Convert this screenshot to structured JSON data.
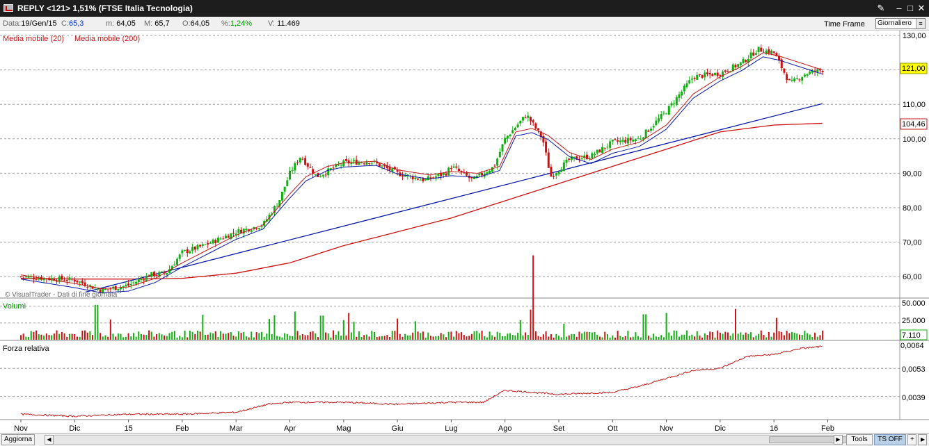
{
  "window": {
    "title": "REPLY <121> 1,51%  (FTSE Italia Tecnologia)",
    "buttons": [
      "tools-icon",
      "minimize-icon",
      "maximize-icon",
      "close-icon"
    ]
  },
  "info": {
    "data_label": "Data:",
    "data_value": "19/Gen/15",
    "c_label": "C:",
    "c_value": "65,3",
    "m_label": "m:",
    "m_value": "64,05",
    "M_label": "M:",
    "M_value": "65,7",
    "o_label": "O:",
    "o_value": "64,05",
    "pct_label": "%:",
    "pct_value": "1,24%",
    "v_label": "V:",
    "v_value": "11.469",
    "timeframe_label": "Time Frame",
    "timeframe_value": "Giornaliero"
  },
  "indicators": {
    "ma20_label": "Media mobile (20)",
    "ma200_label": "Media mobile (200)",
    "watermark": "© VisualTrader - Dati di fine giornata",
    "volume_label": "Volumi",
    "rs_label": "Forza relativa"
  },
  "badges": {
    "last_price": "121,00",
    "ma200_value": "104,46",
    "last_volume": "7.110",
    "rs_last": "0,0064"
  },
  "colors": {
    "up": "#10b010",
    "down": "#d01010",
    "ma20": "#c01818",
    "ma200": "#cc1010",
    "trendline": "#0a1aa8",
    "rs_line": "#c01818",
    "price_badge": "#ffff00"
  },
  "footer": {
    "refresh_label": "Aggiorna",
    "tools_label": "Tools",
    "ts_label": "TS OFF",
    "plus_label": "+"
  },
  "chart_data": {
    "type": "candlestick",
    "price_axis": {
      "ylim": [
        55,
        130
      ],
      "ticks": [
        "130,00",
        "110,00",
        "100,00",
        "90,00",
        "80,00",
        "70,00",
        "60,00"
      ],
      "grid_values": [
        130,
        120,
        110,
        100,
        90,
        80,
        70,
        60
      ]
    },
    "volume_axis": {
      "ticks": [
        "50.000",
        "25.000"
      ],
      "ylim": [
        0,
        55000
      ]
    },
    "rs_axis": {
      "ticks": [
        "0,0064",
        "0,0053",
        "0,0039"
      ],
      "ylim": [
        0.0028,
        0.0066
      ]
    },
    "x_labels": [
      "Nov",
      "Dic",
      "15",
      "Feb",
      "Mar",
      "Apr",
      "Mag",
      "Giu",
      "Lug",
      "Ago",
      "Set",
      "Ott",
      "Nov",
      "Dic",
      "16",
      "Feb"
    ],
    "x_label_months_index": [
      0,
      1,
      2,
      3,
      4,
      5,
      6,
      7,
      8,
      9,
      10,
      11,
      12,
      13,
      14,
      15
    ],
    "close_path": [
      [
        0,
        60
      ],
      [
        1,
        59
      ],
      [
        1.5,
        56
      ],
      [
        2,
        57.5
      ],
      [
        2.4,
        60.5
      ],
      [
        2.7,
        61
      ],
      [
        3,
        67
      ],
      [
        3.4,
        69
      ],
      [
        4,
        73
      ],
      [
        4.5,
        75
      ],
      [
        4.8,
        82
      ],
      [
        5,
        90
      ],
      [
        5.2,
        95
      ],
      [
        5.5,
        89
      ],
      [
        6,
        93
      ],
      [
        6.5,
        93.5
      ],
      [
        7,
        90
      ],
      [
        7.5,
        88
      ],
      [
        7.9,
        90
      ],
      [
        8,
        92
      ],
      [
        8.4,
        88
      ],
      [
        8.8,
        92
      ],
      [
        9,
        100
      ],
      [
        9.4,
        107
      ],
      [
        9.7,
        100
      ],
      [
        9.85,
        89
      ],
      [
        10.2,
        94
      ],
      [
        10.6,
        95
      ],
      [
        11,
        99
      ],
      [
        11.5,
        100
      ],
      [
        12,
        108
      ],
      [
        12.5,
        118
      ],
      [
        13,
        119
      ],
      [
        13.4,
        122
      ],
      [
        13.7,
        126
      ],
      [
        14,
        125
      ],
      [
        14.3,
        116
      ],
      [
        14.6,
        119
      ],
      [
        14.9,
        120
      ]
    ],
    "ma20_path": [
      [
        0,
        60.5
      ],
      [
        1,
        58
      ],
      [
        1.5,
        56.5
      ],
      [
        2,
        57
      ],
      [
        2.5,
        59.5
      ],
      [
        3,
        64
      ],
      [
        3.5,
        68
      ],
      [
        4,
        72
      ],
      [
        4.5,
        75
      ],
      [
        5,
        84
      ],
      [
        5.3,
        89
      ],
      [
        5.7,
        92
      ],
      [
        6,
        93
      ],
      [
        6.6,
        93.5
      ],
      [
        7,
        91
      ],
      [
        7.6,
        89.5
      ],
      [
        8,
        90.5
      ],
      [
        8.5,
        90
      ],
      [
        8.9,
        92
      ],
      [
        9.2,
        102
      ],
      [
        9.5,
        103
      ],
      [
        9.8,
        101
      ],
      [
        10.2,
        96
      ],
      [
        10.6,
        94
      ],
      [
        11,
        97
      ],
      [
        11.5,
        99
      ],
      [
        12,
        104
      ],
      [
        12.5,
        113
      ],
      [
        13,
        118
      ],
      [
        13.4,
        121
      ],
      [
        13.8,
        125
      ],
      [
        14.1,
        124
      ],
      [
        14.5,
        122
      ],
      [
        14.9,
        120
      ]
    ],
    "ma200_path": [
      [
        0,
        59.5
      ],
      [
        1,
        59.3
      ],
      [
        2,
        59.3
      ],
      [
        3,
        59.5
      ],
      [
        4,
        61
      ],
      [
        5,
        64
      ],
      [
        6,
        69
      ],
      [
        7,
        73
      ],
      [
        8,
        77
      ],
      [
        9,
        82
      ],
      [
        10,
        87
      ],
      [
        11,
        92
      ],
      [
        12,
        97
      ],
      [
        13,
        102
      ],
      [
        14,
        104
      ],
      [
        14.9,
        104.5
      ]
    ],
    "trendline": {
      "from": [
        1.2,
        55.5
      ],
      "to": [
        14.9,
        110.2
      ]
    },
    "relative_strength": [
      [
        0,
        0.003
      ],
      [
        1,
        0.0029
      ],
      [
        2,
        0.003
      ],
      [
        3,
        0.003
      ],
      [
        4,
        0.0031
      ],
      [
        4.6,
        0.0035
      ],
      [
        5,
        0.0036
      ],
      [
        6,
        0.0036
      ],
      [
        7,
        0.0035
      ],
      [
        8,
        0.0036
      ],
      [
        8.6,
        0.0036
      ],
      [
        9,
        0.0042
      ],
      [
        10,
        0.004
      ],
      [
        11,
        0.0041
      ],
      [
        11.5,
        0.0044
      ],
      [
        12,
        0.0048
      ],
      [
        12.5,
        0.0052
      ],
      [
        13,
        0.0053
      ],
      [
        13.5,
        0.0059
      ],
      [
        14,
        0.006
      ],
      [
        14.5,
        0.0063
      ],
      [
        14.9,
        0.0064
      ]
    ],
    "volume_profile": {
      "typical": 10000,
      "peaks": [
        [
          1.4,
          52000
        ],
        [
          5.1,
          42000
        ],
        [
          5.6,
          36000
        ],
        [
          6.1,
          40000
        ],
        [
          9.5,
          45000
        ],
        [
          13.3,
          46000
        ],
        [
          12,
          40000
        ],
        [
          11.6,
          38000
        ]
      ]
    }
  }
}
